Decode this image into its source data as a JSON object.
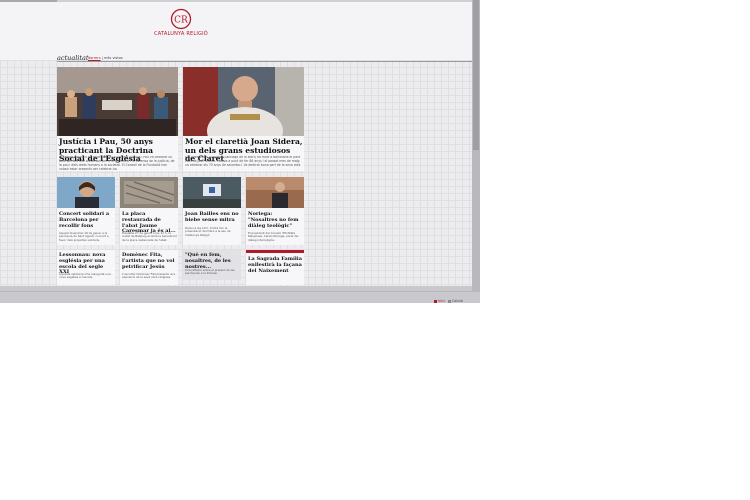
{
  "site": {
    "logo_text": "CATALUNYA RELIGIÓ",
    "logo_monogram": "CR"
  },
  "section": {
    "title": "actualitat",
    "link_active": "darrers",
    "link_other": "més vistos"
  },
  "progress": {
    "fraction": 0.12
  },
  "featured": [
    {
      "title": "Justícia i Pau, 50 anys practicant la Doctrina Social de l'Església",
      "lede": "El passat dilluns 4 de gener de 2018 l'entitat Justícia i Pau va celebrar un acte pel seu 50è aniversari per a la promoció i la defensa de la justícia, de la pau i dels drets humans a la societat. El Consell de la Fundació han volgut estar presents per celebrar-ho."
    },
    {
      "title": "Mor el claretià Joan Sidera, un dels grans estudiosos de Claret",
      "lede": "El Claretianum Augustin (Santiago de la Mort) ha mort a Barcelona el pare claretià Joan Sidera. Estava a punt de fer 86 anys i al passat mes de maig va celebrar els 70 anys de sacerdoci. Va dedicar bona part de la seva vida."
    }
  ],
  "small_cards": [
    {
      "title": "Concert solidari a Barcelona per recollir fons",
      "lede": "Aquest divendres 19 de gener a la parròquia de Sant Agustí, concert a favor dels projectes solidaris."
    },
    {
      "title": "La placa restaurada de l'abat Jaume Caresmar ja és al...",
      "lede": "Dissabte 27 de gener a les 12 h, la ciutat de Bellpuig acollirà la benedicció de la placa restaurada de l'abat."
    },
    {
      "title": "Joan Bailles ens no biebe sense mitra",
      "lede": "Dijous a les 19 h, tindrà lloc la presentació del llibre a la seu de Catalunya Religió."
    },
    {
      "title": "Noriega: \"Nosaltres no fem diàleg teològic\"",
      "lede": "El president del Consell d'Entitats Religioses, Carlos Noriega, parla del diàleg interreligiós."
    },
    {
      "title": "Lessonnau: nova església per una escola del segle XXI",
      "lede": "Aquesta setmana s'ha inaugurat una nova església a l'escola."
    },
    {
      "title": "Domènec Fita, l'artista que no vol petrificar Jesús",
      "lede": "L'escultor Domènec Fita presenta una exposició de la seva obra religiosa."
    },
    {
      "title": "\"Què en fem, nosaltres, de les nostres...",
      "lede": "Una reflexió sobre el present de les parròquies a la Diòcesi."
    },
    {
      "title": "La Sagrada Família enllestirà la façana del Naixement",
      "lede": ""
    }
  ],
  "footer": {
    "link_one": "Inici",
    "link_two": "Català"
  },
  "colors": {
    "accent": "#b2182b",
    "background": "#e9e9ec"
  }
}
